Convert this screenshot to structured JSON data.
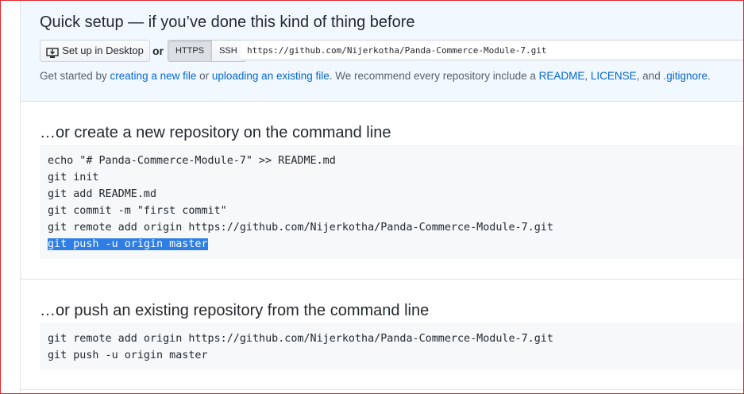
{
  "quick_setup": {
    "title": "Quick setup — if you’ve done this kind of thing before",
    "desktop_button": "Set up in Desktop",
    "or": "or",
    "protocols": [
      "HTTPS",
      "SSH"
    ],
    "selected_protocol": "HTTPS",
    "clone_url": "https://github.com/Nijerkotha/Panda-Commerce-Module-7.git",
    "hint": {
      "p1": "Get started by ",
      "link_new_file": "creating a new file",
      "p2": " or ",
      "link_upload": "uploading an existing file",
      "p3": ". We recommend every repository include a ",
      "link_readme": "README",
      "p4": ", ",
      "link_license": "LICENSE",
      "p5": ", and ",
      "link_gitignore": ".gitignore",
      "p6": "."
    }
  },
  "new_repo": {
    "title": "…or create a new repository on the command line",
    "lines": [
      "echo \"# Panda-Commerce-Module-7\" >> README.md",
      "git init",
      "git add README.md",
      "git commit -m \"first commit\"",
      "git remote add origin https://github.com/Nijerkotha/Panda-Commerce-Module-7.git",
      "git push -u origin master"
    ]
  },
  "existing_repo": {
    "title": "…or push an existing repository from the command line",
    "lines": [
      "git remote add origin https://github.com/Nijerkotha/Panda-Commerce-Module-7.git",
      "git push -u origin master"
    ]
  },
  "colors": {
    "link": "#0366d6",
    "selection": "#2f7ee6",
    "quick_bg": "#f1f8ff",
    "code_bg": "#f6f8fa"
  }
}
